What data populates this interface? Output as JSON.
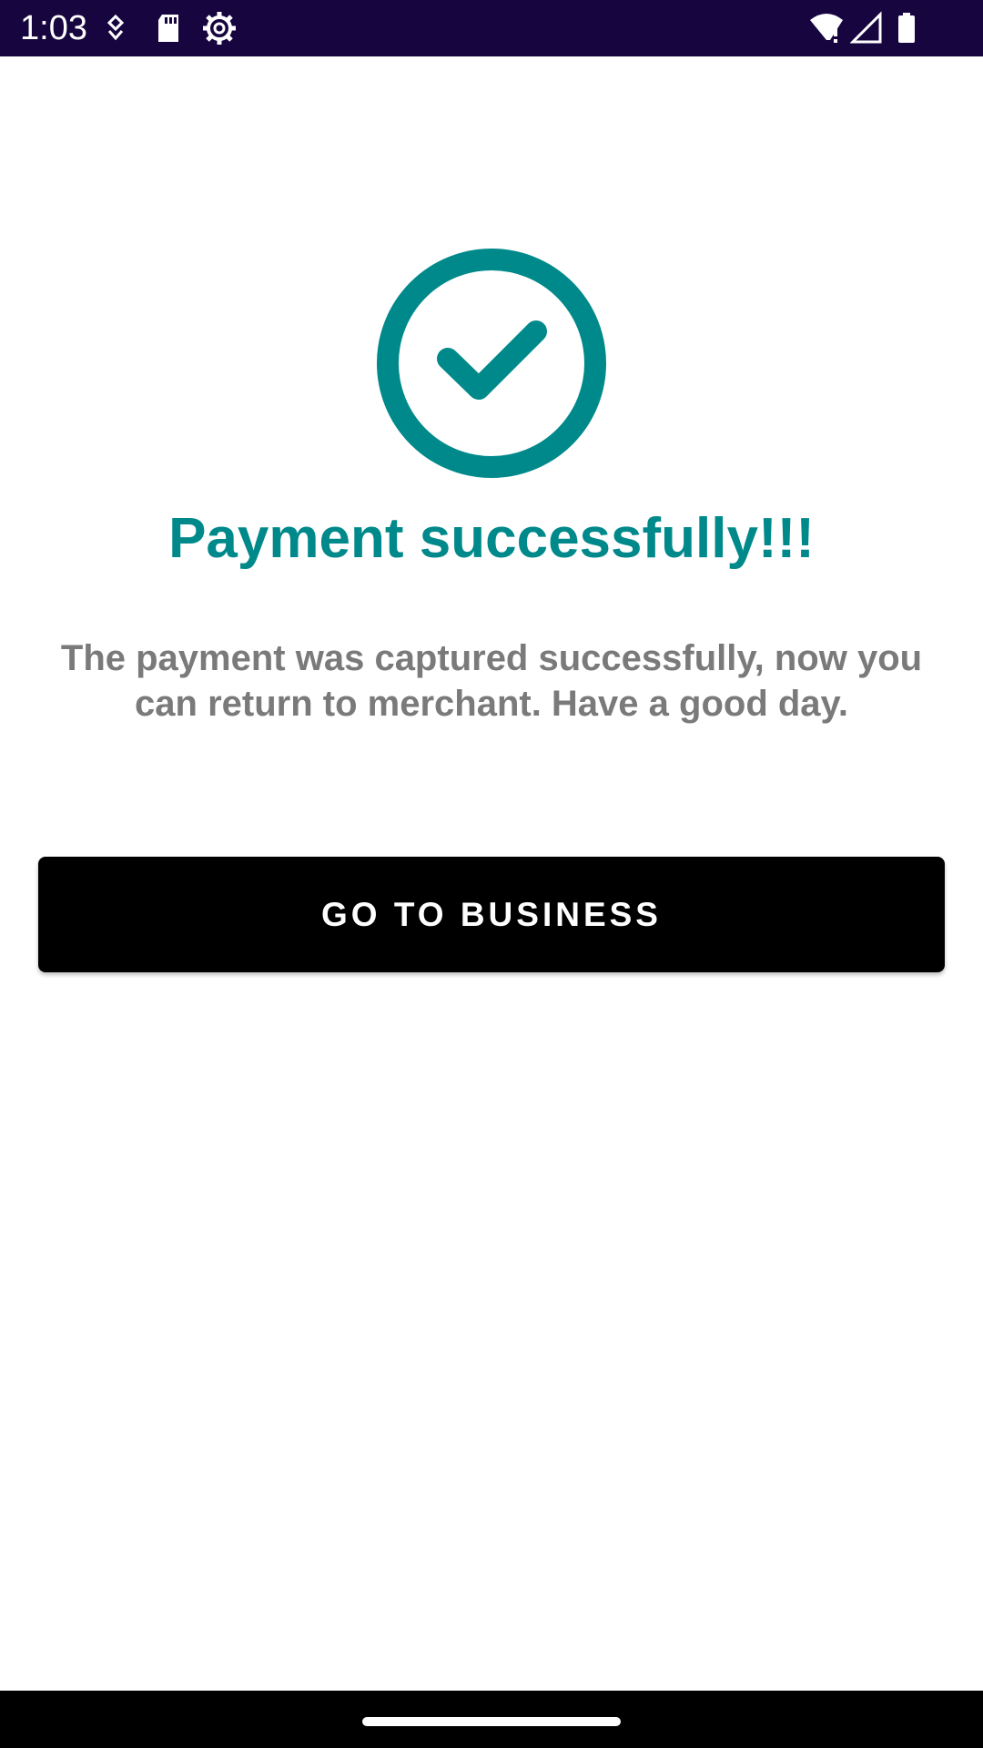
{
  "status_bar": {
    "time": "1:03",
    "left_icons": [
      "notification-dot-icon",
      "sd-card-icon",
      "settings-gear-icon"
    ],
    "right_icons": [
      "wifi-icon",
      "cell-signal-icon",
      "battery-icon"
    ],
    "background_color": "#17053f"
  },
  "content": {
    "icon": "check-circle-icon",
    "accent_color": "#00898a",
    "title": "Payment successfully!!!",
    "message": "The payment was captured successfully, now you can return to merchant. Have a good day.",
    "button_label": "GO TO BUSINESS"
  },
  "nav_bar": {
    "home_indicator": "home-pill"
  }
}
